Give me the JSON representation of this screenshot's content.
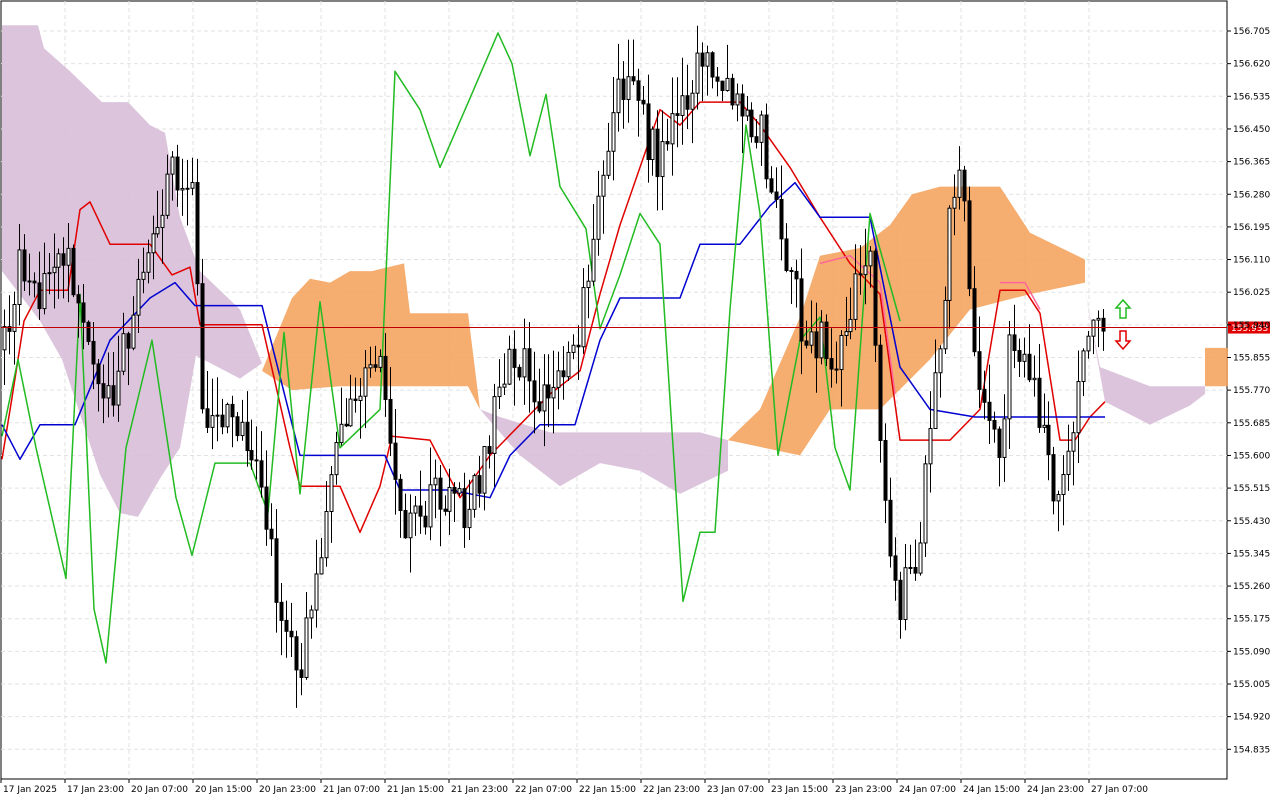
{
  "chart_data": {
    "type": "candlestick",
    "y_ticks": [
      "156.705",
      "156.620",
      "156.535",
      "156.450",
      "156.365",
      "156.280",
      "156.195",
      "156.110",
      "156.025",
      "155.940",
      "155.855",
      "155.770",
      "155.685",
      "155.600",
      "155.515",
      "155.430",
      "155.345",
      "155.260",
      "155.175",
      "155.090",
      "155.005",
      "154.920",
      "154.835"
    ],
    "x_ticks": [
      "17 Jan 2025",
      "17 Jan 23:00",
      "20 Jan 07:00",
      "20 Jan 15:00",
      "20 Jan 23:00",
      "21 Jan 07:00",
      "21 Jan 15:00",
      "21 Jan 23:00",
      "22 Jan 07:00",
      "22 Jan 15:00",
      "22 Jan 23:00",
      "23 Jan 07:00",
      "23 Jan 15:00",
      "23 Jan 23:00",
      "24 Jan 07:00",
      "24 Jan 15:00",
      "24 Jan 23:00",
      "27 Jan 07:00"
    ],
    "current_price": "155.933",
    "ylim": [
      154.79,
      156.78
    ],
    "grid": true,
    "indicator": "Ichimoku Kinko Hyo",
    "colors": {
      "bull_candle": "#ffffff",
      "bear_candle": "#000000",
      "tenkan_sen": "#e00000",
      "kijun_sen": "#0000d0",
      "chikou_span": "#22bb22",
      "kumo_bullish": "#f4a460",
      "kumo_bearish": "#d8bfd8",
      "price_line": "#c00000",
      "price_label_bg": "#e00000",
      "up_arrow": "#22bb22",
      "down_arrow": "#e00000"
    }
  }
}
